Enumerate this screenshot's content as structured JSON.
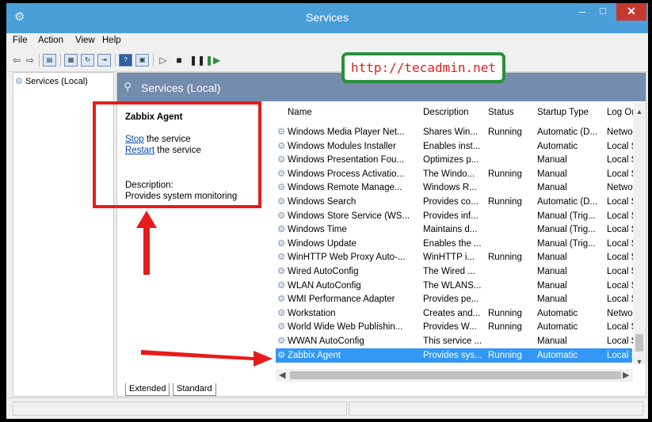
{
  "window": {
    "title": "Services",
    "controls": {
      "minimize": "–",
      "maximize": "□",
      "close": "✕"
    }
  },
  "menu": [
    "File",
    "Action",
    "View",
    "Help"
  ],
  "tree": {
    "root": "Services (Local)"
  },
  "panel": {
    "header": "Services (Local)"
  },
  "details": {
    "service_name": "Zabbix Agent",
    "stop_link": "Stop",
    "stop_rest": " the service",
    "restart_link": "Restart",
    "restart_rest": " the service",
    "description_label": "Description:",
    "description_text": "Provides system monitoring"
  },
  "columns": [
    "Name",
    "Description",
    "Status",
    "Startup Type",
    "Log On A"
  ],
  "rows": [
    {
      "name": "Windows Media Player Net...",
      "description": "Shares Win...",
      "status": "Running",
      "startup": "Automatic (D...",
      "logon": "Network"
    },
    {
      "name": "Windows Modules Installer",
      "description": "Enables inst...",
      "status": "",
      "startup": "Automatic",
      "logon": "Local Sys"
    },
    {
      "name": "Windows Presentation Fou...",
      "description": "Optimizes p...",
      "status": "",
      "startup": "Manual",
      "logon": "Local Ser"
    },
    {
      "name": "Windows Process Activatio...",
      "description": "The Windo...",
      "status": "Running",
      "startup": "Manual",
      "logon": "Local Sys"
    },
    {
      "name": "Windows Remote Manage...",
      "description": "Windows R...",
      "status": "",
      "startup": "Manual",
      "logon": "Network"
    },
    {
      "name": "Windows Search",
      "description": "Provides co...",
      "status": "Running",
      "startup": "Automatic (D...",
      "logon": "Local Sys"
    },
    {
      "name": "Windows Store Service (WS...",
      "description": "Provides inf...",
      "status": "",
      "startup": "Manual (Trig...",
      "logon": "Local Sys"
    },
    {
      "name": "Windows Time",
      "description": "Maintains d...",
      "status": "",
      "startup": "Manual (Trig...",
      "logon": "Local Ser"
    },
    {
      "name": "Windows Update",
      "description": "Enables the ...",
      "status": "",
      "startup": "Manual (Trig...",
      "logon": "Local Sys"
    },
    {
      "name": "WinHTTP Web Proxy Auto-...",
      "description": "WinHTTP i...",
      "status": "Running",
      "startup": "Manual",
      "logon": "Local Ser"
    },
    {
      "name": "Wired AutoConfig",
      "description": "The Wired ...",
      "status": "",
      "startup": "Manual",
      "logon": "Local Sys"
    },
    {
      "name": "WLAN AutoConfig",
      "description": "The WLANS...",
      "status": "",
      "startup": "Manual",
      "logon": "Local Sys"
    },
    {
      "name": "WMI Performance Adapter",
      "description": "Provides pe...",
      "status": "",
      "startup": "Manual",
      "logon": "Local Sys"
    },
    {
      "name": "Workstation",
      "description": "Creates and...",
      "status": "Running",
      "startup": "Automatic",
      "logon": "Network"
    },
    {
      "name": "World Wide Web Publishin...",
      "description": "Provides W...",
      "status": "Running",
      "startup": "Automatic",
      "logon": "Local Sys"
    },
    {
      "name": "WWAN AutoConfig",
      "description": "This service ...",
      "status": "",
      "startup": "Manual",
      "logon": "Local Ser"
    },
    {
      "name": "Zabbix Agent",
      "description": "Provides sys...",
      "status": "Running",
      "startup": "Automatic",
      "logon": "Local Sys",
      "selected": true
    }
  ],
  "tabs": [
    "Extended",
    "Standard"
  ],
  "watermark": "http://tecadmin.net",
  "colors": {
    "titlebar": "#4a9fd9",
    "header_band": "#748cad",
    "selection": "#3297f6",
    "annotation_red": "#e61c1c",
    "watermark_border": "#2a8f3c"
  }
}
